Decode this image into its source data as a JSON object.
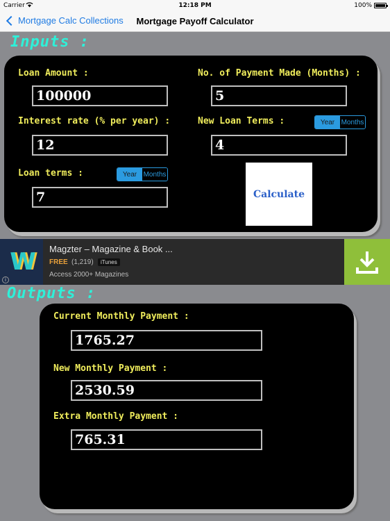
{
  "status_bar": {
    "carrier": "Carrier",
    "time": "12:18 PM",
    "battery": "100%"
  },
  "nav": {
    "back_label": "Mortgage Calc Collections",
    "title": "Mortgage Payoff Calculator"
  },
  "inputs": {
    "heading": "Inputs :",
    "loan_amount": {
      "label": "Loan Amount :",
      "value": "100000"
    },
    "payments_made": {
      "label": "No. of Payment Made (Months) :",
      "value": "5"
    },
    "interest_rate": {
      "label": "Interest rate (% per year) :",
      "value": "12"
    },
    "new_loan_terms": {
      "label": "New Loan Terms :",
      "value": "4",
      "seg_year": "Year",
      "seg_months": "Months",
      "selected": "Year"
    },
    "loan_terms": {
      "label": "Loan terms :",
      "value": "7",
      "seg_year": "Year",
      "seg_months": "Months",
      "selected": "Year"
    },
    "calculate_label": "Calculate"
  },
  "ad": {
    "title": "Magzter – Magazine & Book ...",
    "price": "FREE",
    "ratings": "(1,219)",
    "store": "iTunes",
    "subtitle": "Access 2000+ Magazines",
    "info": "i"
  },
  "outputs": {
    "heading": "Outputs :",
    "current_payment": {
      "label": "Current Monthly Payment :",
      "value": "1765.27"
    },
    "new_payment": {
      "label": "New Monthly Payment :",
      "value": "2530.59"
    },
    "extra_payment": {
      "label": "Extra Monthly Payment :",
      "value": "765.31"
    }
  },
  "colors": {
    "accent": "#2b9be0",
    "label": "#f0ed5c",
    "heading": "#2ff0d8",
    "background": "#8a8b8f"
  }
}
